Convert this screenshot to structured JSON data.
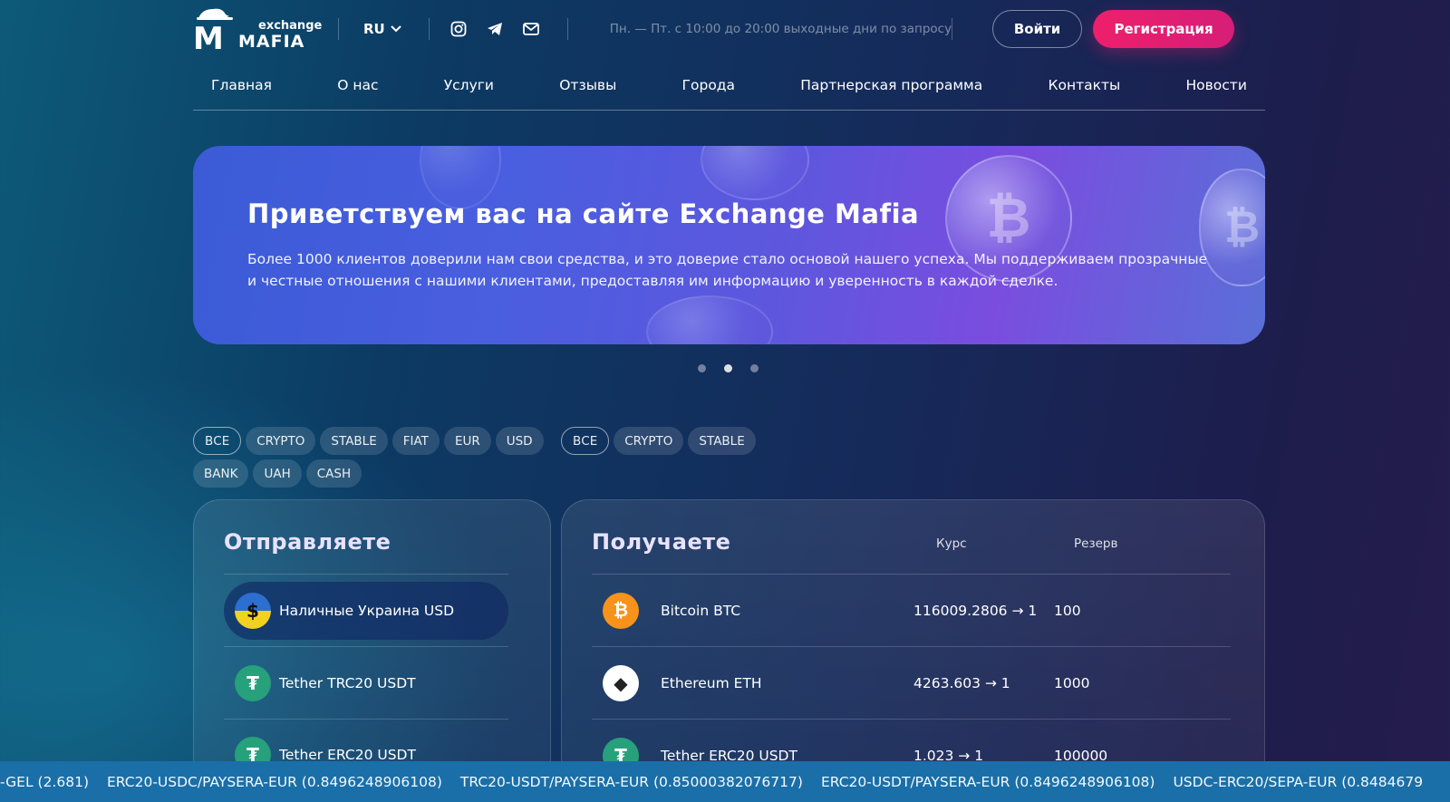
{
  "header": {
    "logo_text_top": "exchange",
    "logo_text_main": "MAFIA",
    "language": "RU",
    "hours": "Пн. — Пт. с 10:00 до 20:00 выходные дни по запросу",
    "login_label": "Войти",
    "register_label": "Регистрация"
  },
  "nav": [
    "Главная",
    "О нас",
    "Услуги",
    "Отзывы",
    "Города",
    "Партнерская программа",
    "Контакты",
    "Новости"
  ],
  "banner": {
    "title": "Приветствуем вас на сайте Exchange Mafia",
    "text": "Более 1000 клиентов доверили нам свои средства, и это доверие стало основой нашего успеха. Мы поддерживаем прозрачные и честные отношения с нашими клиентами, предоставляя им информацию и уверенность в каждой сделке."
  },
  "carousel": {
    "count": 3,
    "active": 2
  },
  "filters_send": {
    "row1": [
      "ВСЕ",
      "CRYPTO",
      "STABLE",
      "FIAT",
      "EUR",
      "USD"
    ],
    "row2": [
      "BANK",
      "UAH",
      "CASH"
    ],
    "active": "ВСЕ"
  },
  "filters_receive": {
    "row1": [
      "ВСЕ",
      "CRYPTO",
      "STABLE"
    ],
    "active": "ВСЕ"
  },
  "send_panel": {
    "title": "Отправляете",
    "items": [
      {
        "name": "Наличные Украина USD",
        "icon": "ua-usd-icon",
        "selected": true
      },
      {
        "name": "Tether TRC20 USDT",
        "icon": "tether-icon",
        "selected": false
      },
      {
        "name": "Tether ERC20 USDT",
        "icon": "tether-icon",
        "selected": false
      }
    ]
  },
  "receive_panel": {
    "title": "Получаете",
    "col_rate": "Курс",
    "col_reserve": "Резерв",
    "rows": [
      {
        "name": "Bitcoin BTC",
        "icon": "bitcoin-icon",
        "rate": "116009.2806 → 1",
        "reserve": "100"
      },
      {
        "name": "Ethereum ETH",
        "icon": "ethereum-icon",
        "rate": "4263.603 → 1",
        "reserve": "1000"
      },
      {
        "name": "Tether ERC20 USDT",
        "icon": "tether-icon",
        "rate": "1.023 → 1",
        "reserve": "100000"
      }
    ]
  },
  "ticker": [
    "-GEL (2.681)",
    "ERC20-USDC/PAYSERA-EUR (0.8496248906108)",
    "TRC20-USDT/PAYSERA-EUR (0.85000382076717)",
    "ERC20-USDT/PAYSERA-EUR (0.8496248906108)",
    "USDC-ERC20/SEPA-EUR (0.8484679"
  ],
  "colors": {
    "accent_pink": "#ee1f6b",
    "ticker_bg": "#1a6fa8",
    "bitcoin": "#f7931a",
    "tether": "#26a17b"
  }
}
